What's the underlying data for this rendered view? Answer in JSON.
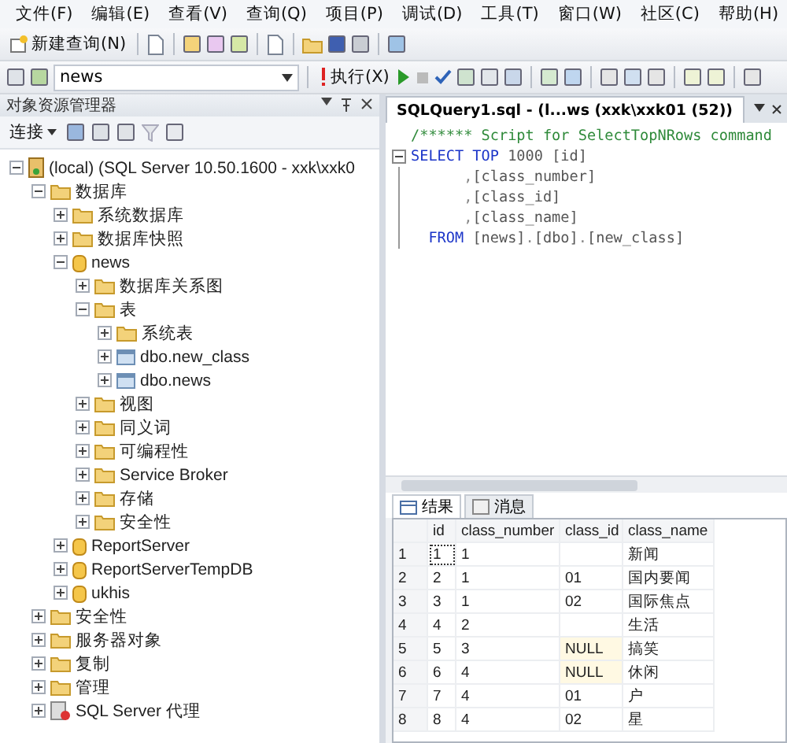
{
  "menu": [
    "文件(F)",
    "编辑(E)",
    "查看(V)",
    "查询(Q)",
    "项目(P)",
    "调试(D)",
    "工具(T)",
    "窗口(W)",
    "社区(C)",
    "帮助(H)"
  ],
  "toolbar": {
    "new_query": "新建查询(N)",
    "database": "news",
    "execute": "执行(X)"
  },
  "explorer": {
    "title": "对象资源管理器",
    "connect": "连接",
    "tree": [
      {
        "label": "(local) (SQL Server 10.50.1600 - xxk\\xxk0",
        "kind": "server",
        "expanded": true,
        "children": [
          {
            "label": "数据库",
            "kind": "folder",
            "expanded": true,
            "children": [
              {
                "label": "系统数据库",
                "kind": "folder",
                "expanded": false
              },
              {
                "label": "数据库快照",
                "kind": "folder",
                "expanded": false
              },
              {
                "label": "news",
                "kind": "database",
                "expanded": true,
                "children": [
                  {
                    "label": "数据库关系图",
                    "kind": "folder",
                    "expanded": false
                  },
                  {
                    "label": "表",
                    "kind": "folder",
                    "expanded": true,
                    "children": [
                      {
                        "label": "系统表",
                        "kind": "folder",
                        "expanded": false
                      },
                      {
                        "label": "dbo.new_class",
                        "kind": "table",
                        "expanded": false
                      },
                      {
                        "label": "dbo.news",
                        "kind": "table",
                        "expanded": false
                      }
                    ]
                  },
                  {
                    "label": "视图",
                    "kind": "folder",
                    "expanded": false
                  },
                  {
                    "label": "同义词",
                    "kind": "folder",
                    "expanded": false
                  },
                  {
                    "label": "可编程性",
                    "kind": "folder",
                    "expanded": false
                  },
                  {
                    "label": "Service Broker",
                    "kind": "folder",
                    "expanded": false
                  },
                  {
                    "label": "存储",
                    "kind": "folder",
                    "expanded": false
                  },
                  {
                    "label": "安全性",
                    "kind": "folder",
                    "expanded": false
                  }
                ]
              },
              {
                "label": "ReportServer",
                "kind": "database",
                "expanded": false
              },
              {
                "label": "ReportServerTempDB",
                "kind": "database",
                "expanded": false
              },
              {
                "label": "ukhis",
                "kind": "database",
                "expanded": false
              }
            ]
          },
          {
            "label": "安全性",
            "kind": "folder",
            "expanded": false
          },
          {
            "label": "服务器对象",
            "kind": "folder",
            "expanded": false
          },
          {
            "label": "复制",
            "kind": "folder",
            "expanded": false
          },
          {
            "label": "管理",
            "kind": "folder",
            "expanded": false
          },
          {
            "label": "SQL Server 代理",
            "kind": "agent",
            "expanded": false
          }
        ]
      }
    ]
  },
  "editor": {
    "tab_title": "SQLQuery1.sql - (l...ws (xxk\\xxk01 (52))",
    "lines": [
      [
        {
          "kind": "comment",
          "text": "/****** Script for SelectTopNRows command"
        }
      ],
      [
        {
          "kind": "keyword",
          "text": "SELECT TOP "
        },
        {
          "kind": "plain",
          "text": "1000 [id]"
        }
      ],
      [
        {
          "kind": "punct",
          "text": "      ,"
        },
        {
          "kind": "plain",
          "text": "[class_number]"
        }
      ],
      [
        {
          "kind": "punct",
          "text": "      ,"
        },
        {
          "kind": "plain",
          "text": "[class_id]"
        }
      ],
      [
        {
          "kind": "punct",
          "text": "      ,"
        },
        {
          "kind": "plain",
          "text": "[class_name]"
        }
      ],
      [
        {
          "kind": "keyword",
          "text": "  FROM "
        },
        {
          "kind": "plain",
          "text": "[news]"
        },
        {
          "kind": "punct",
          "text": "."
        },
        {
          "kind": "plain",
          "text": "[dbo]"
        },
        {
          "kind": "punct",
          "text": "."
        },
        {
          "kind": "plain",
          "text": "[new_class]"
        }
      ]
    ]
  },
  "results": {
    "tabs": [
      {
        "label": "结果",
        "selected": true
      },
      {
        "label": "消息",
        "selected": false
      }
    ],
    "columns": [
      "id",
      "class_number",
      "class_id",
      "class_name"
    ],
    "rows": [
      {
        "number": "1",
        "cells": [
          {
            "text": "1",
            "focused": true,
            "is_null": false
          },
          {
            "text": "1",
            "focused": false,
            "is_null": false
          },
          {
            "focused": false,
            "is_null": false
          },
          {
            "text": "新闻",
            "focused": false,
            "is_null": false
          }
        ]
      },
      {
        "number": "2",
        "cells": [
          {
            "text": "2",
            "focused": false,
            "is_null": false
          },
          {
            "text": "1",
            "focused": false,
            "is_null": false
          },
          {
            "text": "01",
            "focused": false,
            "is_null": false
          },
          {
            "text": "国内要闻",
            "focused": false,
            "is_null": false
          }
        ]
      },
      {
        "number": "3",
        "cells": [
          {
            "text": "3",
            "focused": false,
            "is_null": false
          },
          {
            "text": "1",
            "focused": false,
            "is_null": false
          },
          {
            "text": "02",
            "focused": false,
            "is_null": false
          },
          {
            "text": "国际焦点",
            "focused": false,
            "is_null": false
          }
        ]
      },
      {
        "number": "4",
        "cells": [
          {
            "text": "4",
            "focused": false,
            "is_null": false
          },
          {
            "text": "2",
            "focused": false,
            "is_null": false
          },
          {
            "focused": false,
            "is_null": false
          },
          {
            "text": "生活",
            "focused": false,
            "is_null": false
          }
        ]
      },
      {
        "number": "5",
        "cells": [
          {
            "text": "5",
            "focused": false,
            "is_null": false
          },
          {
            "text": "3",
            "focused": false,
            "is_null": false
          },
          {
            "text": "NULL",
            "focused": false,
            "is_null": true
          },
          {
            "text": "搞笑",
            "focused": false,
            "is_null": false
          }
        ]
      },
      {
        "number": "6",
        "cells": [
          {
            "text": "6",
            "focused": false,
            "is_null": false
          },
          {
            "text": "4",
            "focused": false,
            "is_null": false
          },
          {
            "text": "NULL",
            "focused": false,
            "is_null": true
          },
          {
            "text": "休闲",
            "focused": false,
            "is_null": false
          }
        ]
      },
      {
        "number": "7",
        "cells": [
          {
            "text": "7",
            "focused": false,
            "is_null": false
          },
          {
            "text": "4",
            "focused": false,
            "is_null": false
          },
          {
            "text": "01",
            "focused": false,
            "is_null": false
          },
          {
            "text": "户",
            "focused": false,
            "is_null": false
          }
        ]
      },
      {
        "number": "8",
        "cells": [
          {
            "text": "8",
            "focused": false,
            "is_null": false
          },
          {
            "text": "4",
            "focused": false,
            "is_null": false
          },
          {
            "text": "02",
            "focused": false,
            "is_null": false
          },
          {
            "text": "星",
            "focused": false,
            "is_null": false
          }
        ]
      }
    ]
  }
}
